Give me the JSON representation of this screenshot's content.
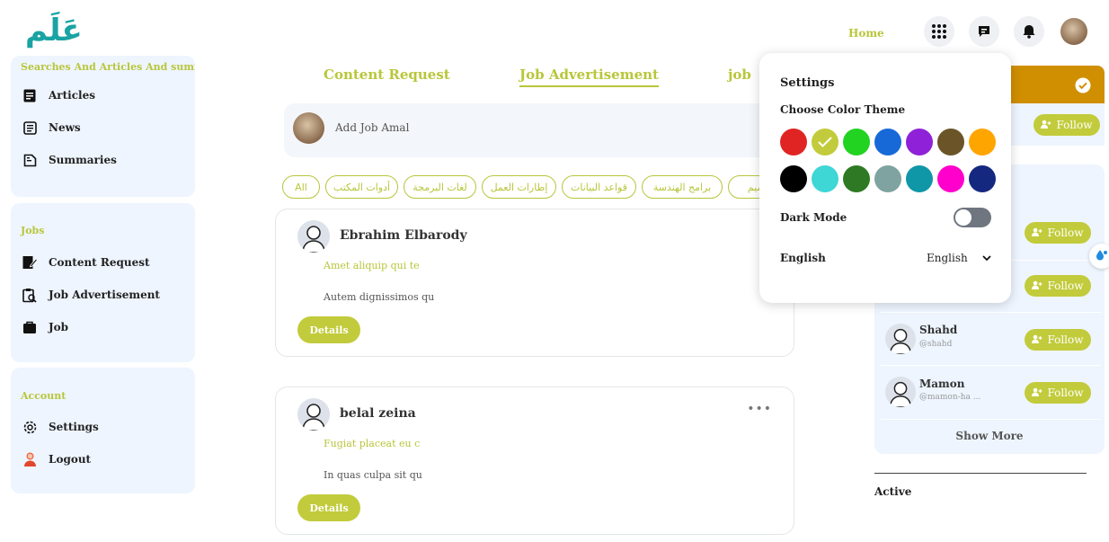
{
  "header": {
    "logo_text": "عَلَم",
    "home_label": "Home"
  },
  "sidebar": {
    "section1": {
      "heading": "Searches And Articles And summ…",
      "items": [
        {
          "label": "Articles",
          "icon": "article-icon"
        },
        {
          "label": "News",
          "icon": "news-icon"
        },
        {
          "label": "Summaries",
          "icon": "summary-icon"
        }
      ]
    },
    "section2": {
      "heading": "Jobs",
      "items": [
        {
          "label": "Content Request",
          "icon": "content-request-icon"
        },
        {
          "label": "Job Advertisement",
          "icon": "job-advertisement-icon"
        },
        {
          "label": "Job",
          "icon": "briefcase-icon"
        }
      ]
    },
    "section3": {
      "heading": "Account",
      "items": [
        {
          "label": "Settings",
          "icon": "gear-icon"
        },
        {
          "label": "Logout",
          "icon": "logout-icon"
        }
      ]
    }
  },
  "tabs": [
    {
      "label": "Content Request"
    },
    {
      "label": "Job Advertisement",
      "active": true
    },
    {
      "label": "job"
    }
  ],
  "add_post": {
    "placeholder": "Add Job Amal"
  },
  "filters": [
    "All",
    "أدوات المكتب",
    "لغات البرمجة",
    "إطارات العمل",
    "قواعد البيانات",
    "برامج الهندسة",
    "التصميم"
  ],
  "posts": [
    {
      "author": "Ebrahim Elbarody",
      "subtitle": "Amet aliquip qui te",
      "body": "Autem dignissimos qu",
      "details_label": "Details"
    },
    {
      "author": "belal zeina",
      "subtitle": "Fugiat placeat eu c",
      "body": "In quas culpa sit qu",
      "details_label": "Details",
      "menu_label": "•••"
    }
  ],
  "right_panel": {
    "follow_label": "Follow",
    "suggestions": [
      {
        "name": "Shahd",
        "handle": "@shahd"
      },
      {
        "name": "Mamon",
        "handle": "@mamon-ha ..."
      }
    ],
    "show_more_label": "Show More",
    "active_label": "Active"
  },
  "settings": {
    "title": "Settings",
    "theme_label": "Choose Color Theme",
    "colors": [
      "#e02424",
      "#c2cb3b",
      "#22d322",
      "#1769d8",
      "#8f22d8",
      "#6b5528",
      "#ffa500",
      "#000000",
      "#3fd6d6",
      "#2e7a24",
      "#7fa3a0",
      "#0f97a8",
      "#ff00cc",
      "#15287f"
    ],
    "selected_color": "#c2cb3b",
    "dark_mode_label": "Dark Mode",
    "dark_mode": false,
    "language_label": "English",
    "language_value": "English"
  }
}
